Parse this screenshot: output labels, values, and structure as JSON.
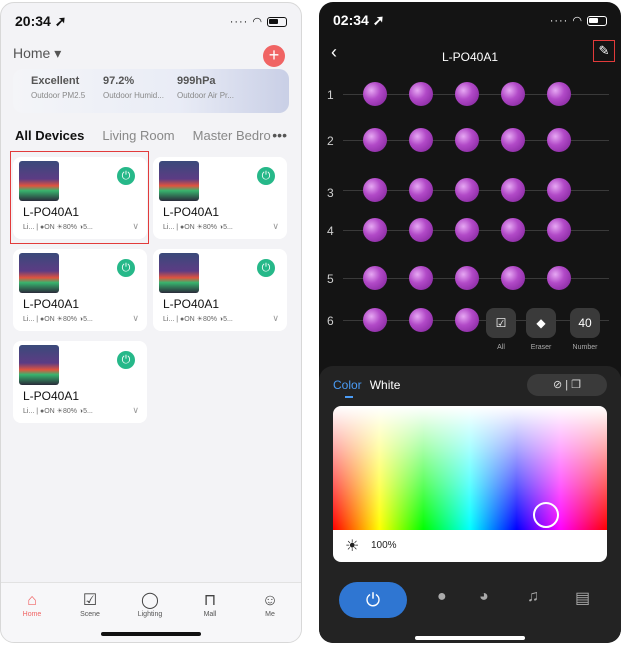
{
  "left": {
    "status": {
      "time": "20:34 ➚"
    },
    "home_label": "Home ▾",
    "add_icon": "plus-icon",
    "weather": [
      {
        "value": "Excellent",
        "label": "Outdoor PM2.5"
      },
      {
        "value": "97.2%",
        "label": "Outdoor Humid..."
      },
      {
        "value": "999hPa",
        "label": "Outdoor Air Pr..."
      }
    ],
    "tabs": [
      "All Devices",
      "Living Room",
      "Master Bedro"
    ],
    "tabs_more": "•••",
    "devices": [
      {
        "name": "L-PO40A1",
        "info": "Li... | ●ON ☀80% ◑5..."
      },
      {
        "name": "L-PO40A1",
        "info": "Li... | ●ON ☀80% ◑5..."
      },
      {
        "name": "L-PO40A1",
        "info": "Li... | ●ON ☀80% ◑5..."
      },
      {
        "name": "L-PO40A1",
        "info": "Li... | ●ON ☀80% ◑5..."
      },
      {
        "name": "L-PO40A1",
        "info": "Li... | ●ON ☀80% ◑5..."
      }
    ],
    "nav": [
      {
        "label": "Home",
        "icon": "home-icon",
        "active": true
      },
      {
        "label": "Scene",
        "icon": "scene-icon"
      },
      {
        "label": "Lighting",
        "icon": "bulb-icon"
      },
      {
        "label": "Mall",
        "icon": "bag-icon"
      },
      {
        "label": "Me",
        "icon": "user-icon"
      }
    ]
  },
  "right": {
    "status": {
      "time": "02:34 ➚"
    },
    "title": "L-PO40A1",
    "rows": [
      "1",
      "2",
      "3",
      "4",
      "5",
      "6"
    ],
    "tools": [
      {
        "label": "All",
        "glyph": "☑"
      },
      {
        "label": "Eraser",
        "glyph": "◆"
      },
      {
        "label": "Number",
        "glyph": "40"
      }
    ],
    "panel": {
      "tab_color": "Color",
      "tab_white": "White",
      "brightness": "100%"
    }
  }
}
